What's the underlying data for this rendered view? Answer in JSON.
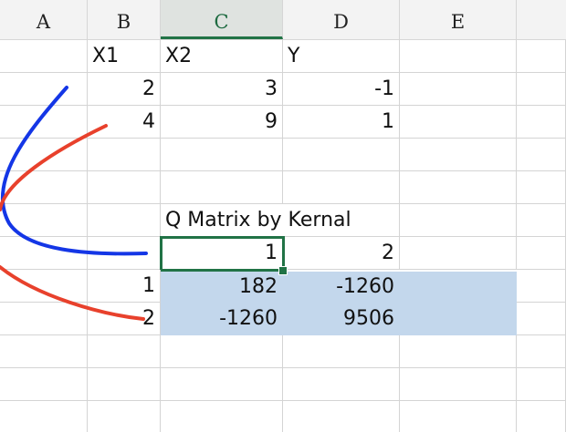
{
  "columns": [
    "A",
    "B",
    "C",
    "D",
    "E"
  ],
  "rows": {
    "r1": {
      "B": "X1",
      "C": "X2",
      "D": "Y"
    },
    "r2": {
      "B": "2",
      "C": "3",
      "D": "-1"
    },
    "r3": {
      "B": "4",
      "C": "9",
      "D": "1"
    },
    "r6": {
      "C": "Q Matrix by Kernal"
    },
    "r7": {
      "C": "1",
      "D": "2"
    },
    "r8": {
      "B": "1",
      "C": "182",
      "D": "-1260"
    },
    "r9": {
      "B": "2",
      "C": "-1260",
      "D": "9506"
    }
  },
  "annotation_colors": {
    "blue": "#1436e6",
    "red": "#e8412c"
  },
  "grid_color": "#d4d4d4",
  "selection_color": "#c3d7ec",
  "accent": "#217346"
}
